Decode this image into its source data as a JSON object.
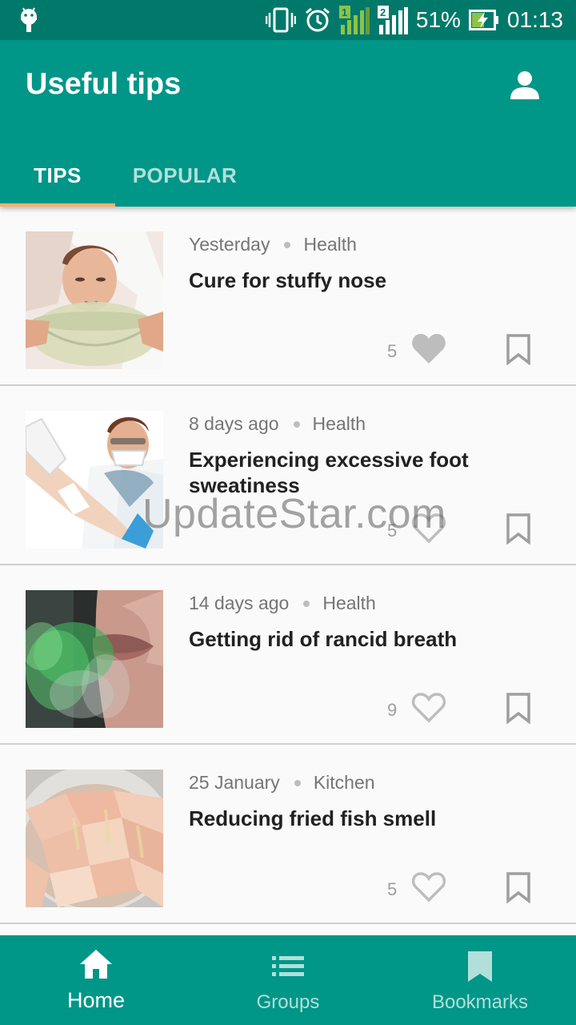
{
  "status_bar": {
    "battery": "51%",
    "time": "01:13",
    "sim1_label": "1",
    "sim2_label": "2"
  },
  "app_bar": {
    "title": "Useful tips",
    "account_icon": "account-icon"
  },
  "tabs": [
    {
      "label": "TIPS",
      "active": true
    },
    {
      "label": "POPULAR",
      "active": false
    }
  ],
  "tips": [
    {
      "date": "Yesterday",
      "category": "Health",
      "title": "Cure for stuffy nose",
      "likes": "5",
      "liked": true
    },
    {
      "date": "8 days ago",
      "category": "Health",
      "title": "Experiencing excessive foot sweatiness",
      "likes": "5",
      "liked": false
    },
    {
      "date": "14 days ago",
      "category": "Health",
      "title": "Getting rid of rancid breath",
      "likes": "9",
      "liked": false
    },
    {
      "date": "25 January",
      "category": "Kitchen",
      "title": "Reducing fried fish smell",
      "likes": "5",
      "liked": false
    }
  ],
  "watermark": "UpdateStar.com",
  "bottom_nav": [
    {
      "label": "Home",
      "icon": "home-icon",
      "active": true
    },
    {
      "label": "Groups",
      "icon": "list-icon",
      "active": false
    },
    {
      "label": "Bookmarks",
      "icon": "bookmark-icon",
      "active": false
    }
  ],
  "colors": {
    "primary": "#009688",
    "primary_dark": "#00796b",
    "tab_indicator": "#f6b26b",
    "liked_heart": "#bdbdbd"
  }
}
